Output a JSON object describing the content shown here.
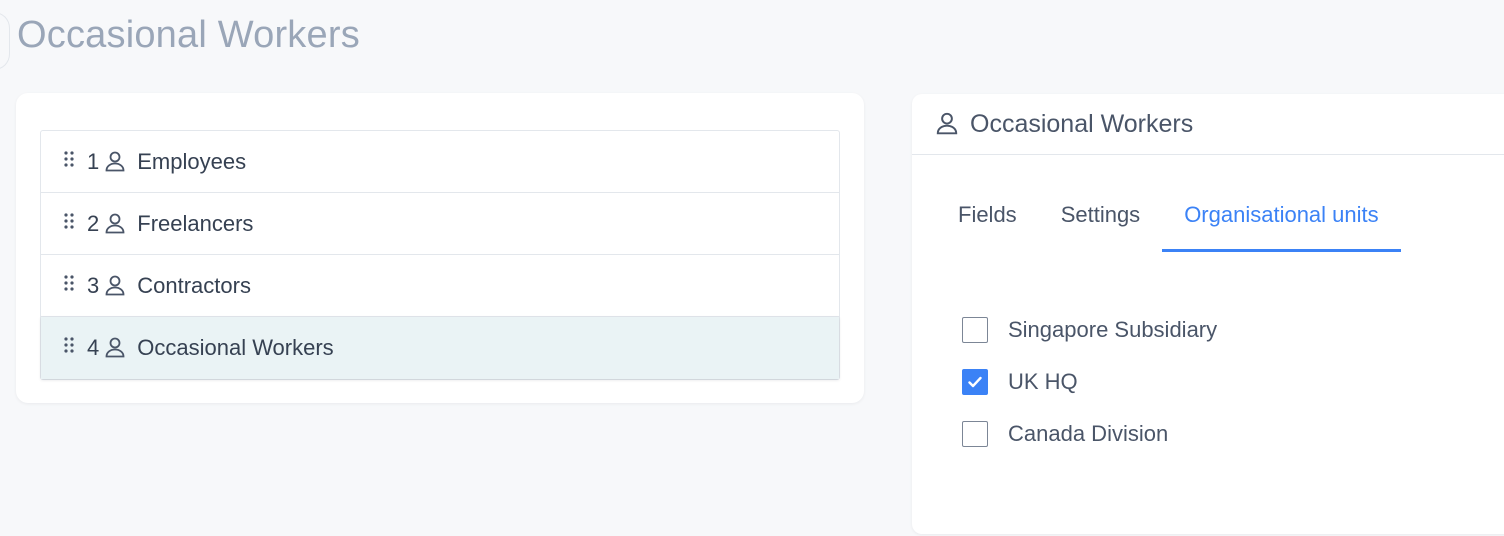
{
  "page": {
    "title": "Occasional Workers"
  },
  "list": {
    "items": [
      {
        "num": "1",
        "label": "Employees",
        "selected": false
      },
      {
        "num": "2",
        "label": "Freelancers",
        "selected": false
      },
      {
        "num": "3",
        "label": "Contractors",
        "selected": false
      },
      {
        "num": "4",
        "label": "Occasional Workers",
        "selected": true
      }
    ]
  },
  "detail": {
    "title": "Occasional Workers",
    "tabs": [
      {
        "label": "Fields",
        "active": false
      },
      {
        "label": "Settings",
        "active": false
      },
      {
        "label": "Organisational units",
        "active": true
      }
    ],
    "units": [
      {
        "label": "Singapore Subsidiary",
        "checked": false
      },
      {
        "label": "UK HQ",
        "checked": true
      },
      {
        "label": "Canada Division",
        "checked": false
      }
    ]
  },
  "colors": {
    "accent": "#3b82f6",
    "selected_row": "#eaf3f5",
    "title": "#9aa6b8"
  },
  "icons": {
    "drag": "drag-handle-icon",
    "person": "person-icon",
    "check": "checkmark-icon"
  }
}
